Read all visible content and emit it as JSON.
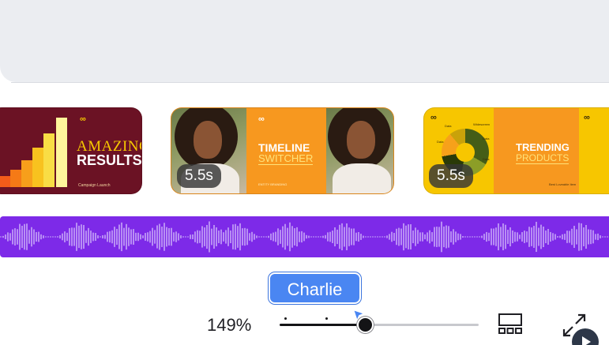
{
  "timeline": {
    "clips": [
      {
        "title": "AMAZING",
        "subtitle": "RESULTS",
        "footer": "Campaign Launch"
      },
      {
        "title": "TIMELINE",
        "subtitle": "SWITCHER",
        "footer": "ENTITY BRANDING",
        "duration": "5.5s"
      },
      {
        "title": "TRENDING",
        "subtitle": "PRODUCTS",
        "footer": "Best Loveable Item",
        "duration": "5.5s",
        "chart_labels": [
          "Data",
          "Data",
          "Widescreen",
          "Data",
          "Data",
          "Data"
        ]
      }
    ]
  },
  "audio": {
    "track_color": "#7d2ae8"
  },
  "tooltip": {
    "text": "Charlie"
  },
  "zoom": {
    "label": "149%",
    "level_fraction": 0.43
  },
  "colors": {
    "accent": "#7d2ae8",
    "tooltip": "#4a86f2",
    "clip_maroon": "#6b1224",
    "clip_orange": "#f7981f",
    "clip_yellow": "#f7c600"
  },
  "icons": [
    "grid-view-icon",
    "expand-icon",
    "play-icon",
    "logo-icon"
  ]
}
